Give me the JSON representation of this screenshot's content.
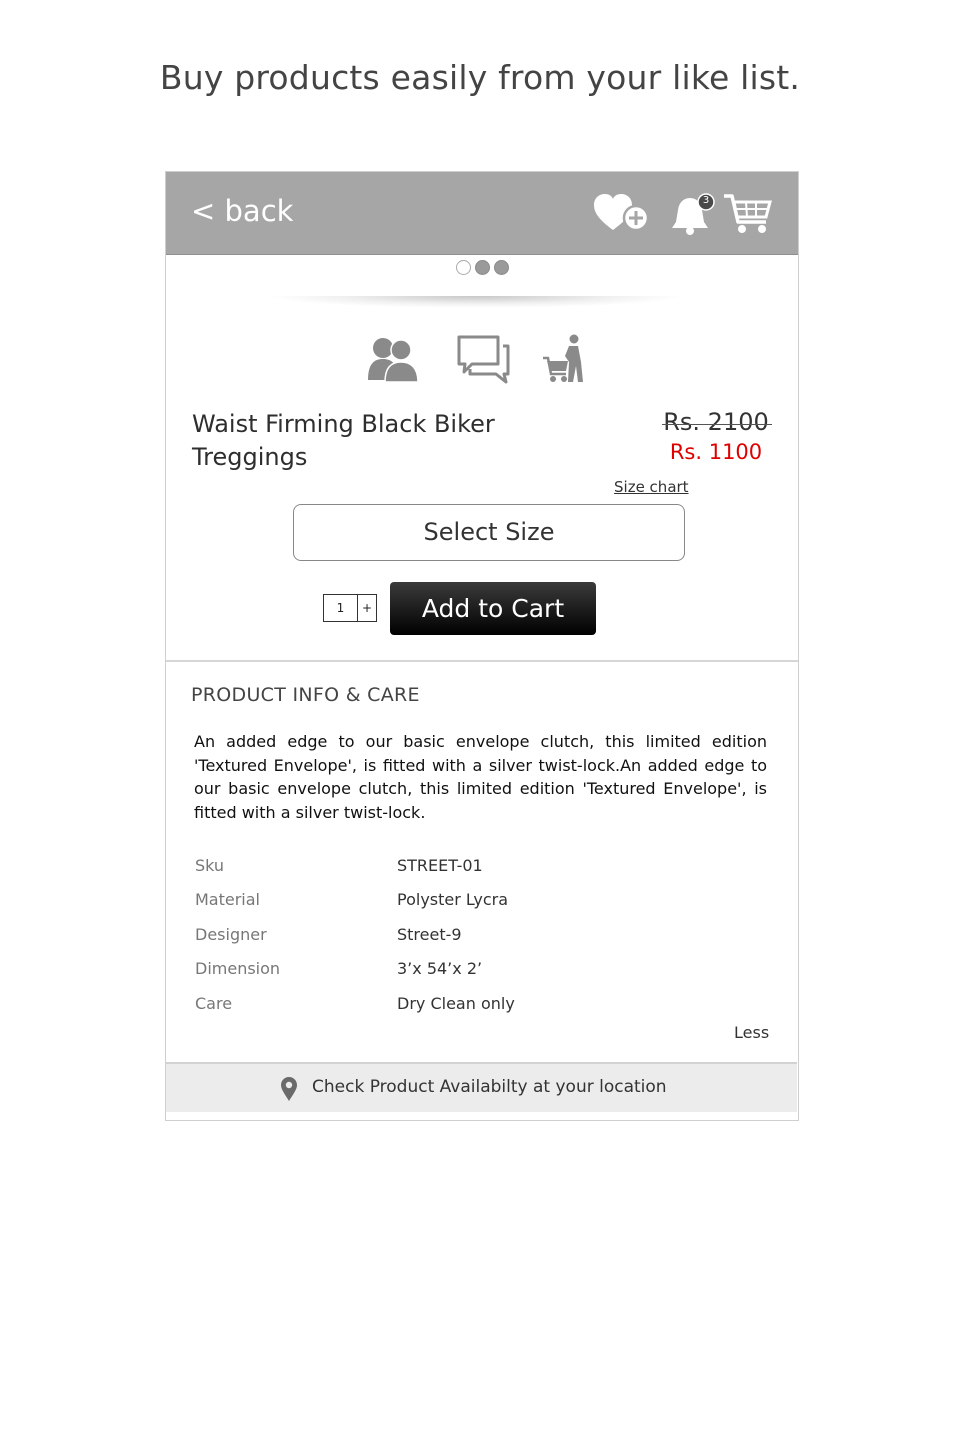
{
  "headline": "Buy products easily from your like list.",
  "header": {
    "back_label": "< back",
    "notification_count": "3",
    "icons": [
      "heart-plus-icon",
      "bell-icon",
      "cart-icon"
    ],
    "background": "#a7a6a6"
  },
  "carousel": {
    "total": 3,
    "active_index": 0
  },
  "action_icons": [
    "people-icon",
    "chat-icon",
    "shopper-icon"
  ],
  "product": {
    "title": "Waist Firming Black Biker Treggings",
    "price_old": "Rs. 2100",
    "price_new": "Rs. 1100",
    "size_chart_label": "Size chart",
    "select_size_label": "Select Size",
    "quantity": "1",
    "qty_plus_label": "+",
    "add_to_cart_label": "Add to Cart"
  },
  "info": {
    "heading": "PRODUCT INFO & CARE",
    "description": "An added edge to our basic envelope clutch, this limited edition 'Textured Envelope', is fitted with a silver twist-lock.An added edge to our basic envelope clutch, this limited edition 'Textured Envelope', is fitted with a silver twist-lock.",
    "specs": [
      {
        "key": "Sku",
        "value": "STREET-01"
      },
      {
        "key": "Material",
        "value": "Polyster Lycra"
      },
      {
        "key": "Designer",
        "value": "Street-9"
      },
      {
        "key": "Dimension",
        "value": "3’x 54’x 2’"
      },
      {
        "key": "Care",
        "value": "Dry Clean only"
      }
    ],
    "less_label": "Less"
  },
  "availability": {
    "label": "Check Product Availabilty at your location"
  },
  "colors": {
    "sale_price": "#e00000",
    "header_bg": "#a7a6a6",
    "cart_button": "#000000"
  }
}
